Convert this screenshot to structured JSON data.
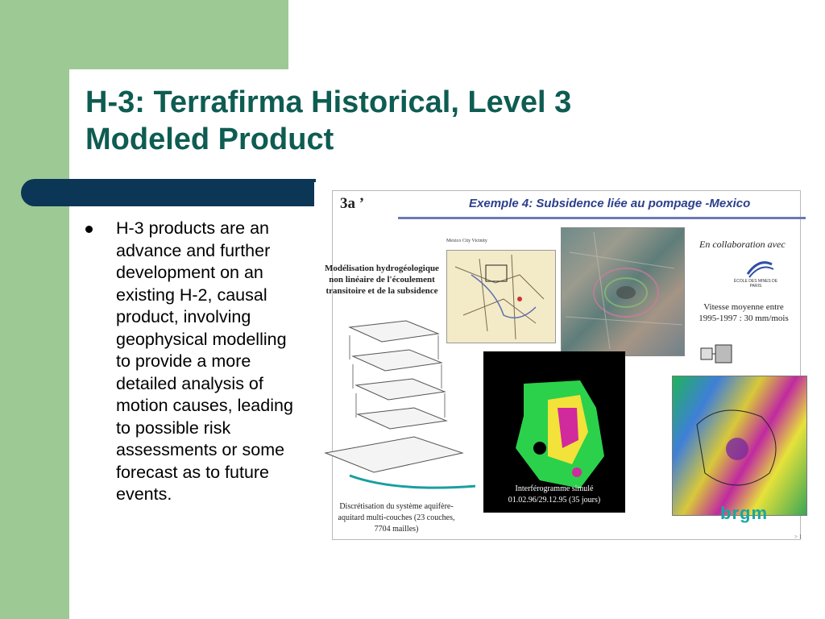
{
  "slide": {
    "title_line1": "H-3: Terrafirma Historical, Level 3",
    "title_line2": "Modeled Product",
    "bullets": [
      "H-3 products are an advance and further development on an existing H-2, causal product, involving geophysical modelling to provide a more detailed analysis of motion causes, leading to possible risk assessments or some forecast as to future events."
    ]
  },
  "figure": {
    "number": "3a ’",
    "header": "Exemple 4: Subsidence  liée au pompage -Mexico",
    "model_title": "Modélisation hydrogéologique non linéaire de l'écoulement transitoire et de la subsidence",
    "map_label": "Mexico City Vicinity",
    "collaboration": "En collaboration avec",
    "logo_text": "ÉCOLE DES MINES DE PARIS",
    "speed_line1": "Vitesse moyenne entre",
    "speed_line2": "1995-1997 : 30 mm/mois",
    "sim_line1": "Interférogramme simulé",
    "sim_line2": "01.02.96/29.12.95 (35 jours)",
    "disc_line1": "Discrétisation du système aquifère-",
    "disc_line2": "aquitard multi-couches (23 couches,",
    "disc_line3": "7704 mailles)",
    "brgm": "brgm",
    "page_marker": "> 1"
  },
  "colors": {
    "green_band": "#9dc995",
    "navy_bar": "#0b3656",
    "title_teal": "#0e5c52",
    "figure_header_blue": "#2b3f8c",
    "brgm_teal": "#1aa6a2"
  }
}
